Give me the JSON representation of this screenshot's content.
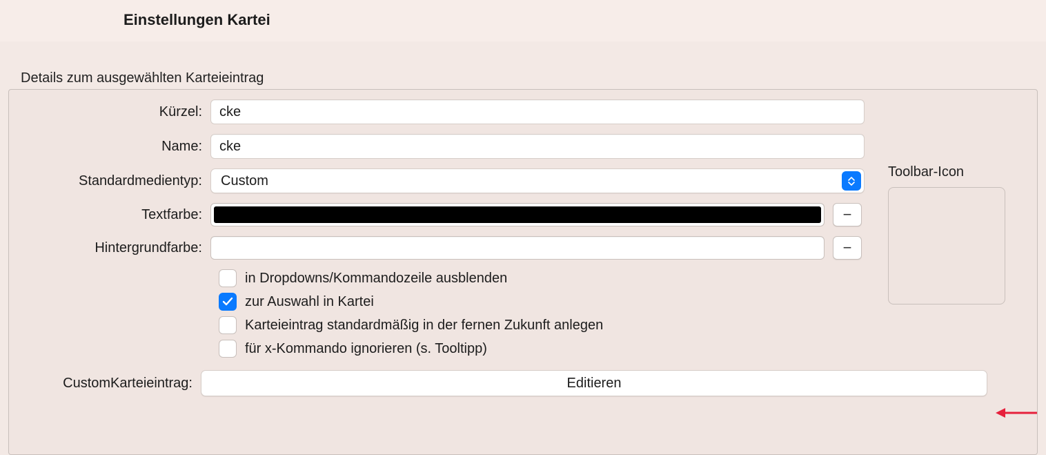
{
  "header": {
    "title": "Einstellungen Kartei"
  },
  "section": {
    "label": "Details zum ausgewählten Karteieintrag"
  },
  "form": {
    "kuerzel": {
      "label": "Kürzel:",
      "value": "cke"
    },
    "name": {
      "label": "Name:",
      "value": "cke"
    },
    "medientyp": {
      "label": "Standardmedientyp:",
      "selected": "Custom"
    },
    "textfarbe": {
      "label": "Textfarbe:",
      "color": "#000000",
      "remove": "−"
    },
    "hintergrundfarbe": {
      "label": "Hintergrundfarbe:",
      "color": "#ffffff",
      "remove": "−"
    },
    "checkboxes": [
      {
        "label": "in Dropdowns/Kommandozeile ausblenden",
        "checked": false
      },
      {
        "label": "zur Auswahl in Kartei",
        "checked": true
      },
      {
        "label": "Karteieintrag standardmäßig in der fernen Zukunft anlegen",
        "checked": false
      },
      {
        "label": "für x-Kommando ignorieren (s. Tooltipp)",
        "checked": false
      }
    ],
    "custom": {
      "label": "CustomKarteieintrag:",
      "button": "Editieren"
    },
    "toolbar_icon": {
      "label": "Toolbar-Icon"
    }
  }
}
